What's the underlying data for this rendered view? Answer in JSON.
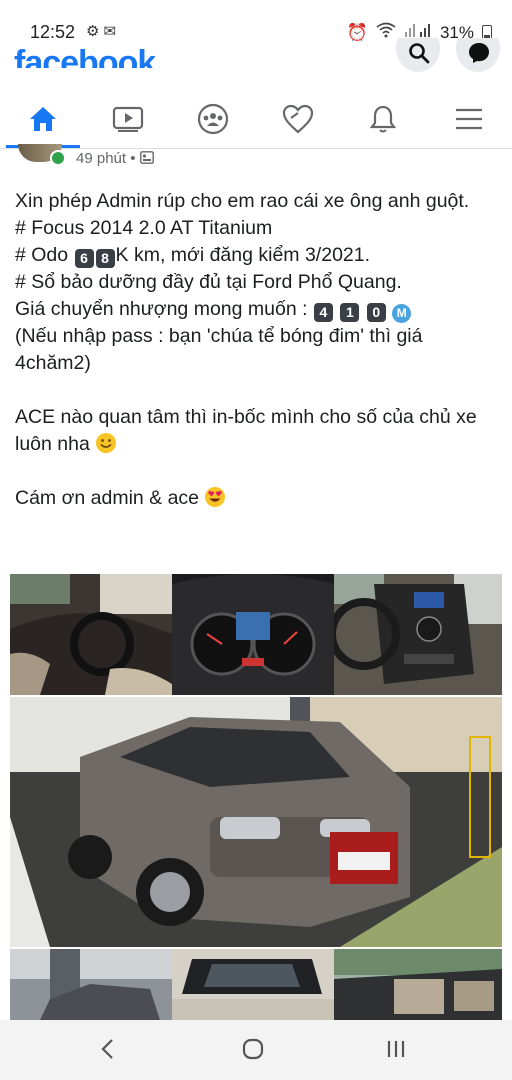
{
  "status": {
    "time": "12:52",
    "battery": "31%"
  },
  "app": {
    "logo": "facebook"
  },
  "nav": [
    "home-icon",
    "video-icon",
    "groups-icon",
    "dating-icon",
    "notifications-icon",
    "menu-icon"
  ],
  "post": {
    "time": "49 phút",
    "line1": "Xin phép Admin rúp cho em rao cái xe ông anh guột.",
    "line2": "# Focus 2014 2.0 AT Titanium",
    "line3_prefix": "# Odo ",
    "odo_digits": [
      "6",
      "8"
    ],
    "line3_suffix": "K km, mới đăng kiểm 3/2021.",
    "line4": "# Sổ bảo dưỡng đầy đủ tại Ford Phổ Quang.",
    "line5_prefix": "Giá chuyển nhượng mong muốn : ",
    "price_digits": [
      "4",
      "1",
      "0"
    ],
    "price_m": "M",
    "line6": "(Nếu nhập pass : bạn 'chúa tể bóng đim' thì giá 4chăm2)",
    "line7": "ACE nào quan tâm thì in-bốc mình cho số của chủ xe luôn nha",
    "line8": "Cám ơn admin & ace"
  },
  "colors": {
    "brand": "#1877f2",
    "online": "#31a24c"
  }
}
